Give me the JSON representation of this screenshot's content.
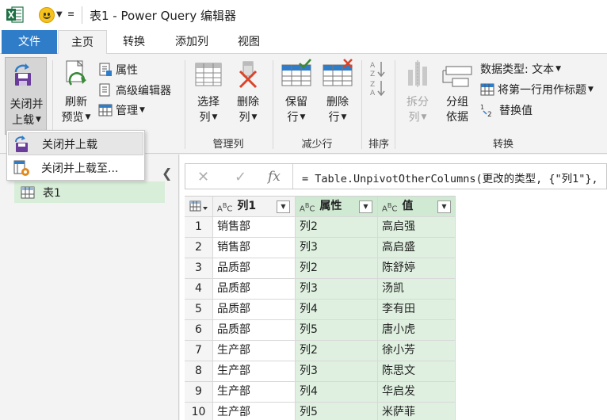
{
  "window": {
    "title": "表1 - Power Query 编辑器"
  },
  "tabs": [
    {
      "label": "文件"
    },
    {
      "label": "主页"
    },
    {
      "label": "转换"
    },
    {
      "label": "添加列"
    },
    {
      "label": "视图"
    }
  ],
  "ribbon": {
    "close_load": {
      "line1": "关闭并",
      "line2": "上载"
    },
    "refresh": {
      "line1": "刷新",
      "line2": "预览"
    },
    "properties": "属性",
    "advanced_editor": "高级编辑器",
    "manage": "管理",
    "choose_columns": {
      "line1": "选择",
      "line2": "列"
    },
    "remove_columns": {
      "line1": "删除",
      "line2": "列"
    },
    "group_manage_columns": "管理列",
    "keep_rows": {
      "line1": "保留",
      "line2": "行"
    },
    "remove_rows": {
      "line1": "删除",
      "line2": "行"
    },
    "group_reduce_rows": "减少行",
    "group_sort": "排序",
    "split_column": {
      "line1": "拆分",
      "line2": "列"
    },
    "group_by": {
      "line1": "分组",
      "line2": "依据"
    },
    "data_type": "数据类型: 文本",
    "first_row_header": "将第一行用作标题",
    "replace_values": "替换值",
    "group_transform": "转换",
    "colors": {
      "accent": "#2f7dc9",
      "selected_green": "#dff0e0",
      "excel_green": "#1e7145"
    }
  },
  "dropdown": {
    "items": [
      {
        "label": "关闭并上载"
      },
      {
        "label": "关闭并上载至..."
      }
    ]
  },
  "queries": {
    "items": [
      {
        "label": "表1"
      }
    ]
  },
  "formula": {
    "cancel_glyph": "✕",
    "confirm_glyph": "✓",
    "fx_glyph": "fx",
    "text": "= Table.UnpivotOtherColumns(更改的类型, {\"列1\"},"
  },
  "table": {
    "columns": [
      {
        "name": "列1",
        "type_icon": "text-type-icon"
      },
      {
        "name": "属性",
        "type_icon": "text-type-icon"
      },
      {
        "name": "值",
        "type_icon": "text-type-icon"
      }
    ],
    "rows": [
      {
        "n": "1",
        "c1": "销售部",
        "c2": "列2",
        "c3": "高启强"
      },
      {
        "n": "2",
        "c1": "销售部",
        "c2": "列3",
        "c3": "高启盛"
      },
      {
        "n": "3",
        "c1": "品质部",
        "c2": "列2",
        "c3": "陈舒婷"
      },
      {
        "n": "4",
        "c1": "品质部",
        "c2": "列3",
        "c3": "汤凯"
      },
      {
        "n": "5",
        "c1": "品质部",
        "c2": "列4",
        "c3": "李有田"
      },
      {
        "n": "6",
        "c1": "品质部",
        "c2": "列5",
        "c3": "唐小虎"
      },
      {
        "n": "7",
        "c1": "生产部",
        "c2": "列2",
        "c3": "徐小芳"
      },
      {
        "n": "8",
        "c1": "生产部",
        "c2": "列3",
        "c3": "陈思文"
      },
      {
        "n": "9",
        "c1": "生产部",
        "c2": "列4",
        "c3": "华启发"
      },
      {
        "n": "10",
        "c1": "生产部",
        "c2": "列5",
        "c3": "米萨菲"
      }
    ]
  }
}
